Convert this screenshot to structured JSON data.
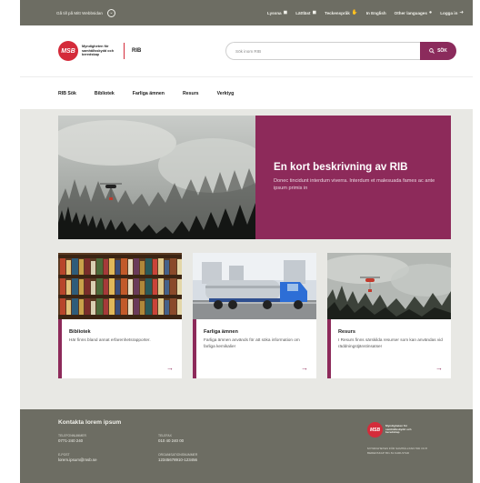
{
  "topbar": {
    "language_link": "Gå till på Mitt Webbsidan",
    "items": [
      {
        "label": "Lyssna",
        "icon": "speaker-icon"
      },
      {
        "label": "Lättläst",
        "icon": "book-icon"
      },
      {
        "label": "Teckenspråk",
        "icon": "hand-icon"
      },
      {
        "label": "In English",
        "icon": ""
      },
      {
        "label": "Other languages",
        "icon": "globe-icon"
      },
      {
        "label": "Logga in",
        "icon": "login-icon"
      }
    ]
  },
  "header": {
    "logo_badge": "MSB",
    "logo_text": "Myndigheten för samhällsskydd och beredskap",
    "site_name": "RIB",
    "search_placeholder": "Sök inom RIB",
    "search_button": "SÖK"
  },
  "nav": {
    "items": [
      "RIB Sök",
      "Bibliotek",
      "Farliga ämnen",
      "Resurs",
      "Verktyg"
    ]
  },
  "hero": {
    "title": "En kort beskrivning av RIB",
    "text": "Donec tincidunt interdum viverra. Interdum et malesuada fames ac ante ipsum primis in"
  },
  "cards": [
    {
      "title": "Bibliotek",
      "text": "Här finns bland annat erfarenhetsrapporter."
    },
    {
      "title": "Farliga ämnen",
      "text": "Farliga ämnen används för att söka information om farliga kemikalier"
    },
    {
      "title": "Resurs",
      "text": "I Resurs finns särskilda resurser som kan användas vid räddningstjänstinsatser"
    }
  ],
  "footer": {
    "title": "Kontakta lorem ipsum",
    "phone_label": "TELEFONNUMMER",
    "phone": "0771-240 240",
    "fax_label": "TELEFAX",
    "fax": "010 40 240 00",
    "email_label": "E-POST",
    "email": "lorem.ipsum@msb.se",
    "org_label": "ORGANISATIONSNUMMER",
    "org": "12345678910-123456",
    "logo_badge": "MSB",
    "logo_text": "Myndigheten för samhällsskydd och beredskap",
    "address": "MYNDIGHETEN FÖR SAMHÄLLSSKYDD OCH BEREDSKAP 651 81 KARLSTAD"
  },
  "colors": {
    "accent": "#8d2a5a",
    "brand_red": "#d42b3a",
    "topbar_bg": "#6d6d63",
    "page_bg": "#e8e8e4"
  }
}
